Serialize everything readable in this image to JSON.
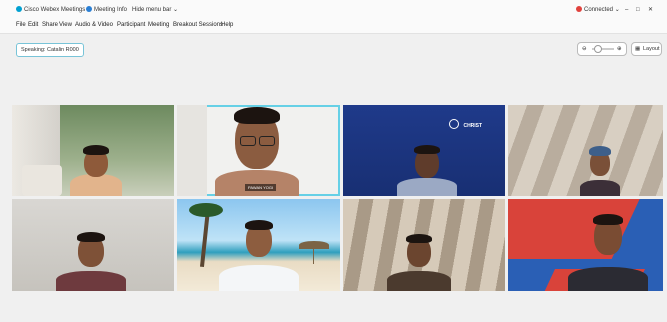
{
  "titlebar": {
    "tabs": [
      "Cisco Webex Meetings",
      "Meeting Info",
      "Hide menu bar"
    ],
    "connected_label": "Connected",
    "window_controls": [
      "chevron-down-icon",
      "minimize-icon",
      "maximize-icon",
      "close-icon"
    ]
  },
  "menu": [
    "File",
    "Edit",
    "Share",
    "View",
    "Audio & Video",
    "Participant",
    "Meeting",
    "Breakout Sessions",
    "Help"
  ],
  "speaking": {
    "label": "Speaking: Catalin R000"
  },
  "toolbar": {
    "layout_label": "Layout"
  },
  "tiles": [
    {
      "name": ""
    },
    {
      "name": "PAWAN YOGI"
    },
    {
      "name": "",
      "logo": "CHRIST"
    },
    {
      "name": ""
    },
    {
      "name": ""
    },
    {
      "name": ""
    },
    {
      "name": ""
    },
    {
      "name": ""
    }
  ],
  "colors": {
    "accent": "#66d0e6",
    "connected": "#e0413c",
    "webex": "#00a0d1"
  }
}
